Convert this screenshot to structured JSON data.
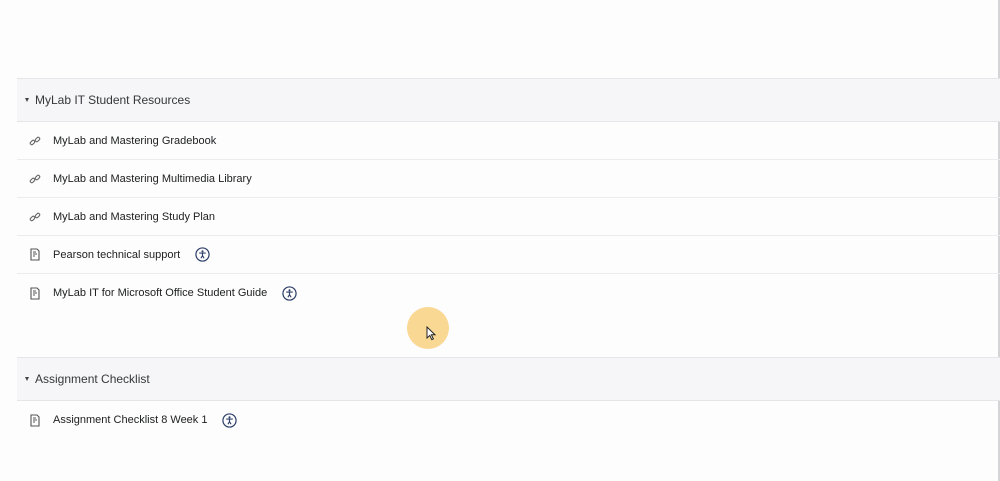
{
  "sections": [
    {
      "title": "MyLab IT Student Resources",
      "items": [
        {
          "label": "MyLab and Mastering Gradebook",
          "icon": "link-icon",
          "accessibility": false
        },
        {
          "label": "MyLab and Mastering Multimedia Library",
          "icon": "link-icon",
          "accessibility": false
        },
        {
          "label": "MyLab and Mastering Study Plan",
          "icon": "link-icon",
          "accessibility": false
        },
        {
          "label": "Pearson technical support",
          "icon": "document-icon",
          "accessibility": true
        },
        {
          "label": "MyLab IT for Microsoft Office Student Guide",
          "icon": "document-icon",
          "accessibility": true
        }
      ]
    },
    {
      "title": "Assignment Checklist",
      "items": [
        {
          "label": "Assignment Checklist 8 Week 1",
          "icon": "document-icon",
          "accessibility": true
        }
      ]
    }
  ],
  "colors": {
    "header_bg": "#f6f6f9",
    "accessibility_icon": "#2c3e68",
    "cursor_highlight": "#f7d180"
  }
}
